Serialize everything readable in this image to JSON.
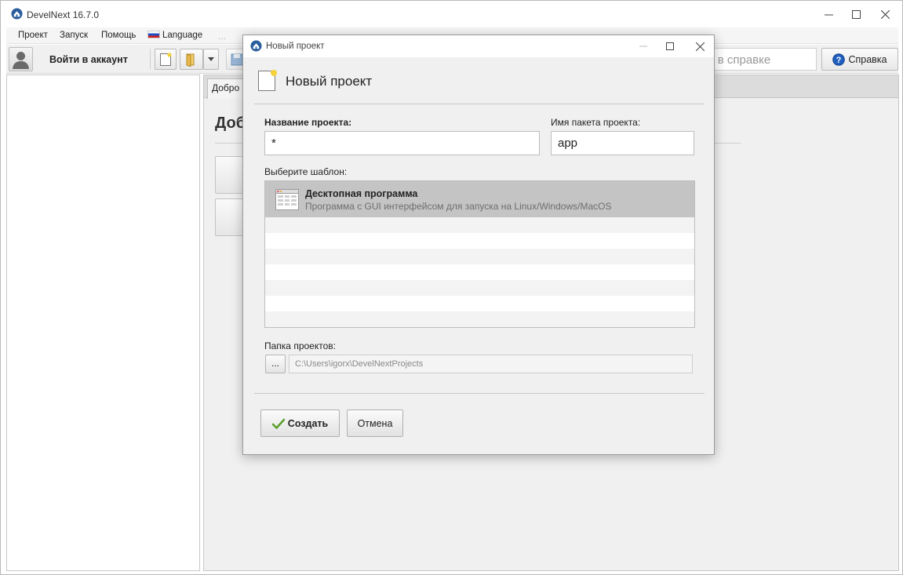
{
  "app": {
    "title": "DevelNext 16.7.0"
  },
  "menu": {
    "items": [
      "Проект",
      "Запуск",
      "Помощь"
    ],
    "language_label": "Language",
    "overflow": "..."
  },
  "toolbar": {
    "login_label": "Войти в аккаунт",
    "search_placeholder": "к в справке",
    "help_label": "Справка"
  },
  "workspace": {
    "tab_label": "Добро п",
    "heading": "Добро"
  },
  "dialog": {
    "window_title": "Новый проект",
    "heading": "Новый проект",
    "project_name_label": "Название проекта:",
    "project_name_value": "*",
    "package_label": "Имя пакета проекта:",
    "package_value": "app",
    "template_label": "Выберите шаблон:",
    "templates": [
      {
        "title": "Десктопная программа",
        "description": "Программа с GUI интерфейсом для запуска на Linux/Windows/MacOS",
        "selected": true
      }
    ],
    "folder_label": "Папка проектов:",
    "browse_label": "...",
    "folder_path": "C:\\Users\\igorx\\DevelNextProjects",
    "create_label": "Создать",
    "cancel_label": "Отмена"
  },
  "colors": {
    "selected_row": "#c4c4c4",
    "dialog_bg": "#f0f0f0",
    "accent_blue": "#1f5fbf",
    "check_green": "#5aa02c"
  },
  "icons": [
    "app-logo-icon",
    "minimize-icon",
    "maximize-icon",
    "close-icon",
    "user-avatar-icon",
    "new-file-icon",
    "open-folder-icon",
    "dropdown-arrow-icon",
    "save-icon",
    "help-icon",
    "new-project-icon",
    "desktop-app-icon",
    "checkmark-icon"
  ]
}
